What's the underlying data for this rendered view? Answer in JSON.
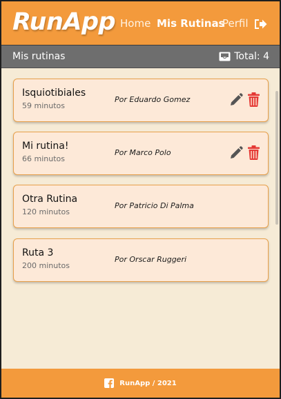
{
  "header": {
    "logo": "RunApp",
    "nav": [
      {
        "label": "Home"
      },
      {
        "label": "Mis Rutinas"
      },
      {
        "label": "Perfil"
      }
    ]
  },
  "subbar": {
    "title": "Mis rutinas",
    "total": "Total: 4"
  },
  "routines": [
    {
      "name": "Isquiotibiales",
      "minutes": "59 minutos",
      "author": "Por Eduardo Gomez",
      "editable": true
    },
    {
      "name": "Mi rutina!",
      "minutes": "66 minutos",
      "author": "Por Marco Polo",
      "editable": true
    },
    {
      "name": "Otra Rutina",
      "minutes": "120 minutos",
      "author": "Por Patricio Di Palma",
      "editable": false
    },
    {
      "name": "Ruta 3",
      "minutes": "200 minutos",
      "author": "Por Orscar Ruggeri",
      "editable": false
    }
  ],
  "footer": {
    "text": "RunApp / 2021"
  },
  "colors": {
    "brand_orange": "#f39a3c",
    "subbar_gray": "#6e6e6e",
    "background": "#f6ebd6",
    "card_bg": "#fde9d8",
    "delete_red": "#e53935",
    "edit_gray": "#555555"
  },
  "icons": {
    "logout": "sign-out-icon",
    "total": "inbox-icon",
    "edit": "pencil-icon",
    "delete": "trash-icon",
    "footer": "facebook-icon"
  }
}
